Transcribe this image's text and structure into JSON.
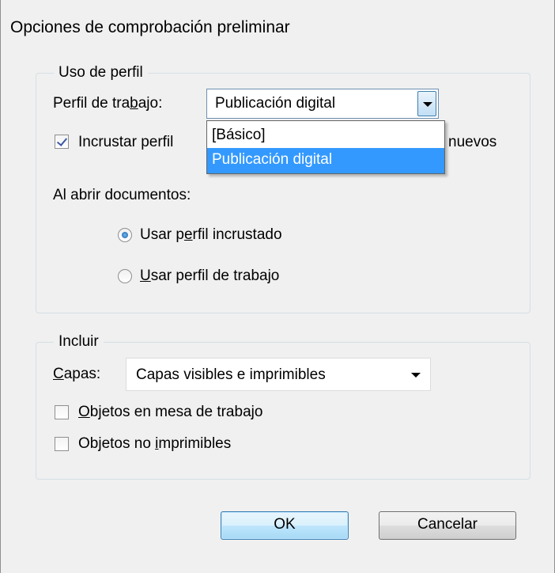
{
  "dialog": {
    "title": "Opciones de comprobación preliminar"
  },
  "profile_usage": {
    "legend": "Uso de perfil",
    "working_profile_label_pre": "Perfil de tra",
    "working_profile_label_u": "b",
    "working_profile_label_post": "ajo:",
    "working_profile_value": "Publicación digital",
    "dropdown_options": [
      {
        "label": "[Básico]",
        "selected": false
      },
      {
        "label": "Publicación digital",
        "selected": true
      }
    ],
    "embed_checkbox_label_visible_left": "Incrustar perfil",
    "embed_checkbox_label_visible_right": "nuevos",
    "embed_checked": true,
    "on_open_label": "Al abrir documentos:",
    "radio_embedded_pre": "Usar p",
    "radio_embedded_u": "e",
    "radio_embedded_post": "rfil incrustado",
    "radio_embedded_checked": true,
    "radio_working_u": "U",
    "radio_working_post": "sar perfil de trabajo",
    "radio_working_checked": false
  },
  "include": {
    "legend": "Incluir",
    "layers_label_u": "C",
    "layers_label_post": "apas:",
    "layers_value": "Capas visibles e imprimibles",
    "artboard_objects_u": "O",
    "artboard_objects_post": "bjetos en mesa de trabajo",
    "artboard_objects_checked": false,
    "nonprintable_pre": "Objetos no ",
    "nonprintable_u": "i",
    "nonprintable_post": "mprimibles",
    "nonprintable_checked": false
  },
  "buttons": {
    "ok": "OK",
    "cancel": "Cancelar"
  },
  "colors": {
    "dialog_bg": "#f0f0f0",
    "selection": "#3399ff",
    "default_button_border": "#3c7fb1"
  }
}
